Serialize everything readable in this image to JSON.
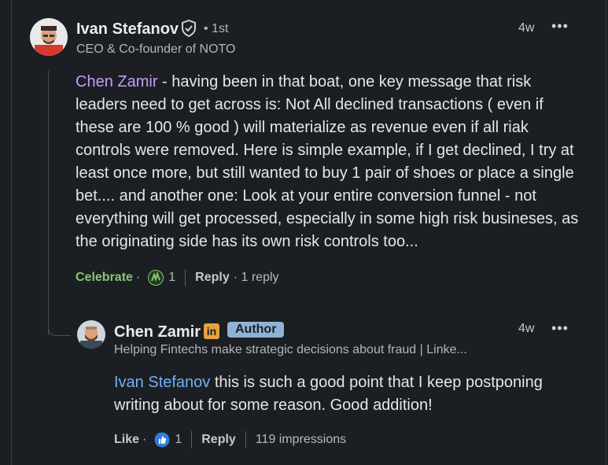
{
  "comment1": {
    "author": "Ivan Stefanov",
    "degree": "• 1st",
    "headline": "CEO & Co-founder of NOTO",
    "time": "4w",
    "more": "•••",
    "mention": "Chen Zamir",
    "text": " - having been in that boat, one key message that risk leaders need to get across is: Not All declined transactions ( even if these are 100 % good ) will materialize as revenue even if all riak controls were removed. Here is simple example, if I get declined, I try at least once more, but still wanted to buy 1 pair of shoes or place a single bet.... and another one: Look at your entire conversion funnel - not everything will get processed, especially in some high risk busineses, as the originating side has its own risk controls too...",
    "reaction_label": "Celebrate",
    "reaction_count": "1",
    "reply_label": "Reply",
    "replies": "· 1 reply"
  },
  "comment2": {
    "author": "Chen Zamir",
    "linkedin_badge": "in",
    "author_badge": "Author",
    "headline": "Helping Fintechs make strategic decisions about fraud | Linke...",
    "time": "4w",
    "more": "•••",
    "mention": "Ivan Stefanov",
    "text": " this is such a good point that I keep postponing writing about for some reason. Good addition!",
    "reaction_label": "Like",
    "reaction_count": "1",
    "reply_label": "Reply",
    "impressions": "119 impressions"
  },
  "icons": {
    "verified": "shield-check-icon",
    "celebrate": "celebrate-hands-icon",
    "like": "thumbs-up-icon"
  }
}
